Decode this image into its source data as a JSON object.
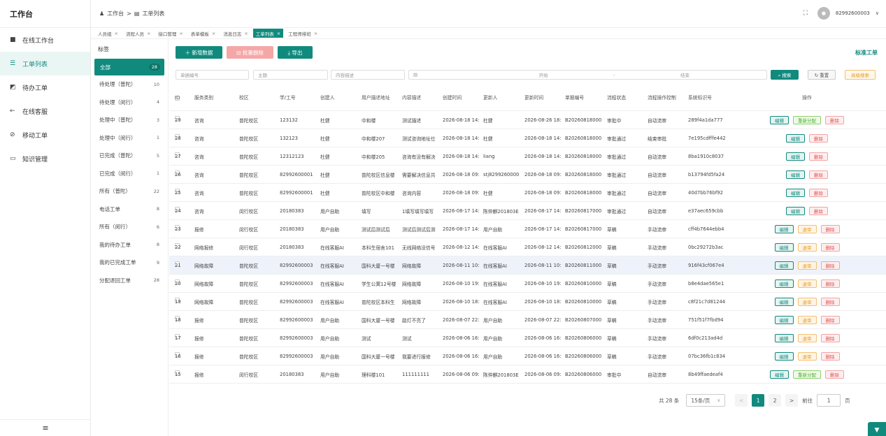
{
  "app": {
    "title": "工作台",
    "menu_icon": "≡"
  },
  "sidebar": {
    "items": [
      {
        "label": "在线工作台",
        "icon": "chat-icon",
        "glyph": "■"
      },
      {
        "label": "工单列表",
        "icon": "list-icon",
        "glyph": "☰"
      },
      {
        "label": "待办工单",
        "icon": "clipboard-icon",
        "glyph": "◩"
      },
      {
        "label": "在线客服",
        "icon": "arrow-left-icon",
        "glyph": "←"
      },
      {
        "label": "移动工单",
        "icon": "link-icon",
        "glyph": "⊘"
      },
      {
        "label": "知识管理",
        "icon": "folder-icon",
        "glyph": "▭"
      }
    ]
  },
  "header": {
    "breadcrumb": [
      "工作台",
      ">",
      "工单列表"
    ],
    "crumb_icons": [
      "user-icon",
      "calendar-icon"
    ],
    "fullscreen_icon": "⛶",
    "username": "82992600003",
    "user_menu_icon": "∨"
  },
  "tabs": [
    {
      "label": "人员组"
    },
    {
      "label": "流程人员"
    },
    {
      "label": "接口管理"
    },
    {
      "label": "表单模板"
    },
    {
      "label": "消息日志"
    },
    {
      "label": "工单列表"
    },
    {
      "label": "工程师排班"
    }
  ],
  "categories": {
    "title": "标签",
    "items": [
      {
        "label": "全部",
        "count": "28"
      },
      {
        "label": "待处理（普陀）",
        "count": "10"
      },
      {
        "label": "待处理（闵行）",
        "count": "4"
      },
      {
        "label": "处理中（普陀）",
        "count": "3"
      },
      {
        "label": "处理中（闵行）",
        "count": "1"
      },
      {
        "label": "已完成（普陀）",
        "count": "5"
      },
      {
        "label": "已完成（闵行）",
        "count": "1"
      },
      {
        "label": "所有（普陀）",
        "count": "22"
      },
      {
        "label": "电话工单",
        "count": "8"
      },
      {
        "label": "所有（闵行）",
        "count": "6"
      },
      {
        "label": "我的待办工单",
        "count": "8"
      },
      {
        "label": "我的已完成工单",
        "count": "9"
      },
      {
        "label": "分配退回工单",
        "count": "28"
      }
    ]
  },
  "toolbar": {
    "add": "＋ 新增数据",
    "batch_delete": "⊟ 批量删除",
    "export": "⤓ 导出",
    "form_title": "标准工单"
  },
  "filters": {
    "order_no": "单据编号",
    "subject": "主题",
    "content": "内容描述",
    "date_icon": "▤",
    "start": "开始",
    "sep": "-",
    "end": "结束",
    "search": "⌕ 搜索",
    "reset": "↻ 重置",
    "advanced": "高级搜索"
  },
  "table": {
    "headers": [
      "ID",
      "服务类别",
      "校区",
      "学/工号",
      "创建人",
      "用户描述地址",
      "内容描述",
      "创建时间",
      "更新人",
      "更新时间",
      "单据编号",
      "流程状态",
      "流程操作控制",
      "系统标识号",
      "操作"
    ],
    "rows": [
      {
        "id": "29",
        "cat": "咨询",
        "campus": "普陀校区",
        "sid": "123132",
        "creator": "杜健",
        "addr": "中和楼",
        "desc": "测试描述",
        "ctime": "2026-08-18 14:",
        "updater": "杜健",
        "utime": "2026-08-26 18:",
        "no": "B20260818000",
        "status": "审批中",
        "ctrl": "自动流审",
        "sys": "289f4a1da777",
        "actions": [
          "编辑",
          "重新分配",
          "删除"
        ]
      },
      {
        "id": "28",
        "cat": "咨询",
        "campus": "普陀校区",
        "sid": "132123",
        "creator": "杜健",
        "addr": "中和楼207",
        "desc": "测试咨询地址仕",
        "ctime": "2026-08-18 14:",
        "updater": "杜健",
        "utime": "2026-08-18 14:",
        "no": "B20260818000",
        "status": "审批通过",
        "ctrl": "结束审批",
        "sys": "7e195cdfffe442",
        "actions": [
          "编辑",
          "删除"
        ]
      },
      {
        "id": "27",
        "cat": "咨询",
        "campus": "普陀校区",
        "sid": "12312123",
        "creator": "杜健",
        "addr": "中和楼205",
        "desc": "咨询有没有解决",
        "ctime": "2026-08-18 14:",
        "updater": "liang",
        "utime": "2026-08-18 14:",
        "no": "B20260818000",
        "status": "审批通过",
        "ctrl": "自动流审",
        "sys": "8ba1910c8037",
        "actions": [
          "编辑",
          "删除"
        ]
      },
      {
        "id": "26",
        "cat": "咨询",
        "campus": "普陀校区",
        "sid": "82992600001",
        "creator": "杜健",
        "addr": "普陀校区信息楼",
        "desc": "需要解决信息共",
        "ctime": "2026-08-18 09:",
        "updater": "stj8299260000",
        "utime": "2026-08-18 09:",
        "no": "B20260818000",
        "status": "审批通过",
        "ctrl": "自动流审",
        "sys": "b13794fd5fa24",
        "actions": [
          "编辑",
          "删除"
        ]
      },
      {
        "id": "25",
        "cat": "咨询",
        "campus": "普陀校区",
        "sid": "82992600001",
        "creator": "杜健",
        "addr": "普陀校区中和楼",
        "desc": "咨询内容",
        "ctime": "2026-08-18 09:",
        "updater": "杜健",
        "utime": "2026-08-18 09:",
        "no": "B20260818000",
        "status": "审批通过",
        "ctrl": "自动流审",
        "sys": "40d7bb76bf92",
        "actions": [
          "编辑",
          "删除"
        ]
      },
      {
        "id": "24",
        "cat": "咨询",
        "campus": "闵行校区",
        "sid": "20180383",
        "creator": "用户自助",
        "addr": "填写",
        "desc": "1填写填写填写",
        "ctime": "2026-08-17 14:",
        "updater": "陈仲麒201803E",
        "utime": "2026-08-17 14:",
        "no": "B20260817000",
        "status": "审批通过",
        "ctrl": "自动流审",
        "sys": "e37aec659cbb",
        "actions": [
          "编辑",
          "删除"
        ]
      },
      {
        "id": "23",
        "cat": "报修",
        "campus": "闵行校区",
        "sid": "20180383",
        "creator": "用户自助",
        "addr": "测试后测试后",
        "desc": "测试后测试后测",
        "ctime": "2026-08-17 14:",
        "updater": "用户自助",
        "utime": "2026-08-17 14:",
        "no": "B20260817000",
        "status": "草稿",
        "ctrl": "手动流审",
        "sys": "cff4b7644ebb4",
        "actions": [
          "编辑",
          "退审",
          "删除"
        ]
      },
      {
        "id": "22",
        "cat": "网络报修",
        "campus": "闵行校区",
        "sid": "20180383",
        "creator": "在线客服AI",
        "addr": "本科生宿舍101",
        "desc": "无线网络没信号",
        "ctime": "2026-08-12 14:",
        "updater": "在线客服AI",
        "utime": "2026-08-12 14:",
        "no": "B20260812000",
        "status": "草稿",
        "ctrl": "手动流审",
        "sys": "0bc29272b3ac",
        "actions": [
          "编辑",
          "退审",
          "删除"
        ]
      },
      {
        "id": "21",
        "cat": "网络故障",
        "campus": "普陀校区",
        "sid": "82992600003",
        "creator": "在线客服AI",
        "addr": "国科大厦一号楼",
        "desc": "网络故障",
        "ctime": "2026-08-11 10:",
        "updater": "在线客服AI",
        "utime": "2026-08-11 10:",
        "no": "B20260811000",
        "status": "草稿",
        "ctrl": "手动流审",
        "sys": "916f43cf067e4",
        "actions": [
          "编辑",
          "退审",
          "删除"
        ]
      },
      {
        "id": "20",
        "cat": "网络故障",
        "campus": "普陀校区",
        "sid": "82992600003",
        "creator": "在线客服AI",
        "addr": "学生公寓12号楼",
        "desc": "网络故障",
        "ctime": "2026-08-10 19:",
        "updater": "在线客服AI",
        "utime": "2026-08-10 19:",
        "no": "B20260810000",
        "status": "草稿",
        "ctrl": "手动流审",
        "sys": "b8e4dae565e1",
        "actions": [
          "编辑",
          "退审",
          "删除"
        ]
      },
      {
        "id": "19",
        "cat": "网络故障",
        "campus": "普陀校区",
        "sid": "82992600003",
        "creator": "在线客服AI",
        "addr": "普陀校区本科生",
        "desc": "网络故障",
        "ctime": "2026-08-10 18:",
        "updater": "在线客服AI",
        "utime": "2026-08-10 18:",
        "no": "B20260810000",
        "status": "草稿",
        "ctrl": "手动流审",
        "sys": "c8f21c7d81244",
        "actions": [
          "编辑",
          "退审",
          "删除"
        ]
      },
      {
        "id": "18",
        "cat": "报修",
        "campus": "普陀校区",
        "sid": "82992600003",
        "creator": "用户自助",
        "addr": "国科大厦一号楼",
        "desc": "路灯不亮了",
        "ctime": "2026-08-07 22:",
        "updater": "用户自助",
        "utime": "2026-08-07 22:",
        "no": "B20260807000",
        "status": "草稿",
        "ctrl": "手动流审",
        "sys": "751f51f7fbd94",
        "actions": [
          "编辑",
          "退审",
          "删除"
        ]
      },
      {
        "id": "17",
        "cat": "报修",
        "campus": "普陀校区",
        "sid": "82992600003",
        "creator": "用户自助",
        "addr": "测试",
        "desc": "测试",
        "ctime": "2026-08-06 16:",
        "updater": "用户自助",
        "utime": "2026-08-06 16:",
        "no": "B20260806000",
        "status": "草稿",
        "ctrl": "手动流审",
        "sys": "6df0c213ad4d",
        "actions": [
          "编辑",
          "退审",
          "删除"
        ]
      },
      {
        "id": "16",
        "cat": "报修",
        "campus": "普陀校区",
        "sid": "82992600003",
        "creator": "用户自助",
        "addr": "国科大厦一号楼",
        "desc": "我要进行报修",
        "ctime": "2026-08-06 16:",
        "updater": "用户自助",
        "utime": "2026-08-06 16:",
        "no": "B20260806000",
        "status": "草稿",
        "ctrl": "手动流审",
        "sys": "07bc36fb1c834",
        "actions": [
          "编辑",
          "退审",
          "删除"
        ]
      },
      {
        "id": "15",
        "cat": "报修",
        "campus": "闵行校区",
        "sid": "20180383",
        "creator": "用户自助",
        "addr": "理科楼101",
        "desc": "111111111",
        "ctime": "2026-08-06 09:",
        "updater": "陈仲麒201803E",
        "utime": "2026-08-06 09:",
        "no": "B20260806000",
        "status": "审批中",
        "ctrl": "自动流审",
        "sys": "8b49ffaedeaf4",
        "actions": [
          "编辑",
          "重新分配",
          "删除"
        ]
      }
    ]
  },
  "pagination": {
    "total": "共 28 条",
    "page_size": "15条/页",
    "dropdown_icon": "∨",
    "prev": "<",
    "pages": [
      "1",
      "2"
    ],
    "next": ">",
    "goto_label": "前往",
    "goto_value": "1",
    "goto_suffix": "页"
  },
  "float_button": "▼",
  "colors": {
    "accent": "#118a7e",
    "danger": "#e05050",
    "warning": "#e69a1c",
    "success": "#4caf30"
  }
}
